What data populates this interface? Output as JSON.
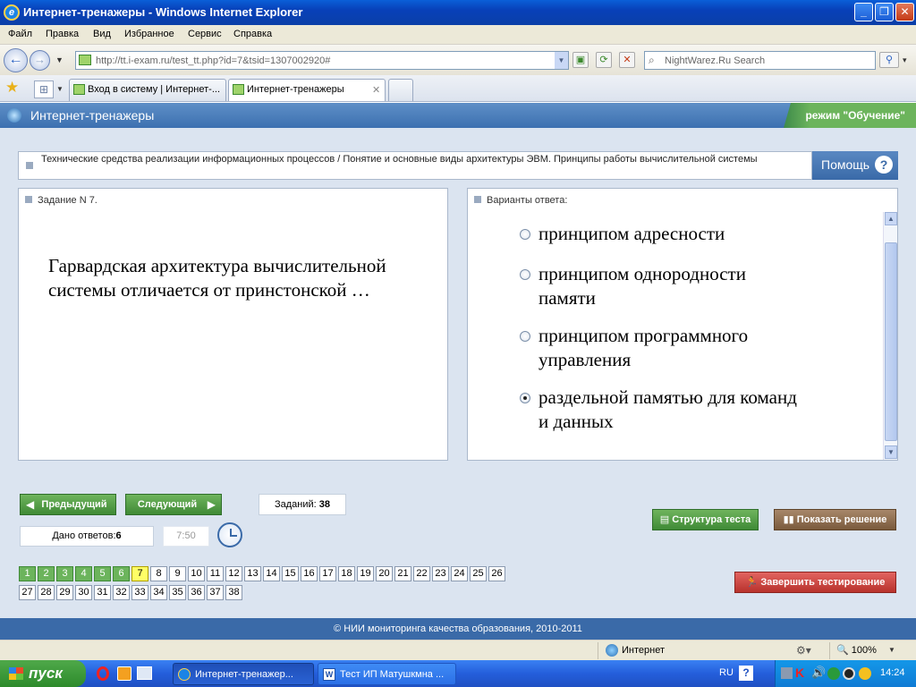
{
  "window": {
    "title": "Интернет-тренажеры - Windows Internet Explorer",
    "minimize": "_",
    "maximize": "❐",
    "close": "✕"
  },
  "menu": [
    "Файл",
    "Правка",
    "Вид",
    "Избранное",
    "Сервис",
    "Справка"
  ],
  "address": {
    "url": "http://tt.i-exam.ru/test_tt.php?id=7&tsid=1307002920#",
    "search_placeholder": "NightWarez.Ru Search"
  },
  "tabs": [
    {
      "label": "Вход в систему | Интернет-...",
      "active": false
    },
    {
      "label": "Интернет-тренажеры",
      "active": true
    }
  ],
  "app": {
    "title": "Интернет-тренажеры",
    "mode": "режим \"Обучение\""
  },
  "topic": "Технические средства реализации информационных процессов / Понятие и основные виды архитектуры ЭВМ. Принципы работы вычислительной системы",
  "help": {
    "label": "Помощь",
    "icon": "?"
  },
  "task": {
    "header": "Задание N 7.",
    "question": "Гарвардская архитектура вычислительной системы отличается от принстонской …"
  },
  "answers": {
    "header": "Варианты ответа:",
    "options": [
      {
        "text": "принципом адресности",
        "selected": false
      },
      {
        "text": "принципом однородности памяти",
        "selected": false
      },
      {
        "text": "принципом программного управления",
        "selected": false
      },
      {
        "text": "раздельной памятью для команд и данных",
        "selected": true
      }
    ]
  },
  "nav": {
    "prev": "Предыдущий",
    "next": "Следующий",
    "tasks_label": "Заданий:",
    "tasks_count": "38",
    "answered_label": "Дано ответов:",
    "answered_count": "6",
    "timer": "7:50"
  },
  "actions": {
    "structure": "Структура теста",
    "show_solution": "Показать решение",
    "finish": "Завершить тестирование"
  },
  "numbers": {
    "done": [
      1,
      2,
      3,
      4,
      5,
      6
    ],
    "current": 7,
    "row1": [
      "1",
      "2",
      "3",
      "4",
      "5",
      "6",
      "7",
      "8",
      "9",
      "10",
      "11",
      "12",
      "13",
      "14",
      "15",
      "16",
      "17",
      "18",
      "19",
      "20",
      "21",
      "22",
      "23",
      "24",
      "25",
      "26"
    ],
    "row2": [
      "27",
      "28",
      "29",
      "30",
      "31",
      "32",
      "33",
      "34",
      "35",
      "36",
      "37",
      "38"
    ]
  },
  "footer": "© НИИ мониторинга качества образования, 2010-2011",
  "statusbar": {
    "zone": "Интернет",
    "zoom": "100%"
  },
  "taskbar": {
    "start": "пуск",
    "tasks": [
      "Интернет-тренажер...",
      "Тест ИП Матушкмна ..."
    ],
    "lang": "RU",
    "clock": "14:24"
  },
  "colors": {
    "accent": "#3a6aa8",
    "green": "#4f9a43",
    "brown": "#8a6a4a",
    "red": "#c9403a",
    "current": "#ffff66"
  }
}
